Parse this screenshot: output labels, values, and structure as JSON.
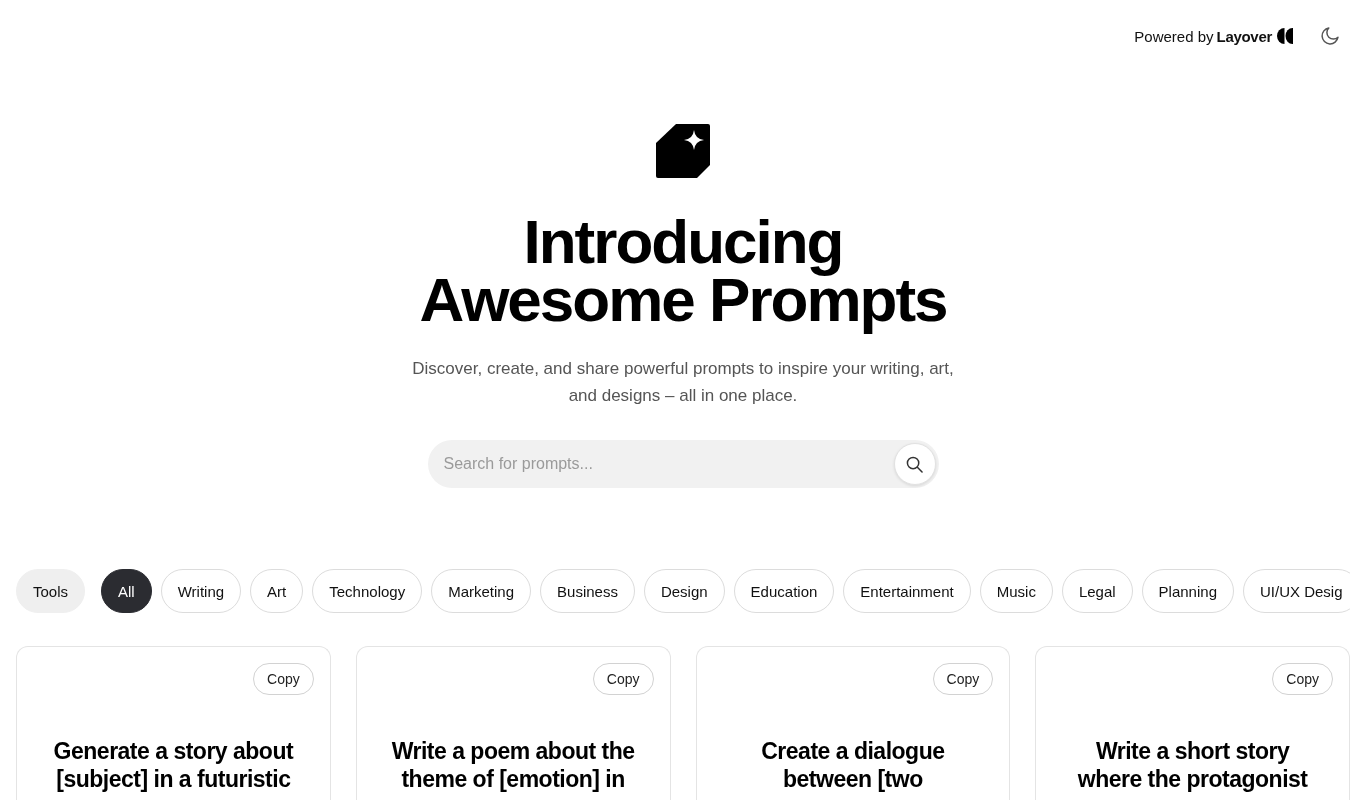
{
  "header": {
    "powered_by": "Powered by **Layover**"
  },
  "hero": {
    "title": "Introducing Awesome Prompts",
    "subtitle": "Discover, create, and share powerful prompts to inspire your writing, art, and designs – all in one place.",
    "search": {
      "placeholder": "Search for prompts..."
    }
  },
  "filters": {
    "tools_button": "Tools",
    "categories": [
      {
        "label": "All",
        "selected": true
      },
      {
        "label": "Writing",
        "selected": false
      },
      {
        "label": "Art",
        "selected": false
      },
      {
        "label": "Technology",
        "selected": false
      },
      {
        "label": "Marketing",
        "selected": false
      },
      {
        "label": "Business",
        "selected": false
      },
      {
        "label": "Design",
        "selected": false
      },
      {
        "label": "Education",
        "selected": false
      },
      {
        "label": "Entertainment",
        "selected": false
      },
      {
        "label": "Music",
        "selected": false
      },
      {
        "label": "Legal",
        "selected": false
      },
      {
        "label": "Planning",
        "selected": false
      },
      {
        "label": "UI/UX Desig",
        "selected": false
      }
    ]
  },
  "prompts": [
    {
      "text": "Generate a story about [subject] in a futuristic",
      "copy_label": "Copy"
    },
    {
      "text": "Write a poem about the theme of [emotion] in",
      "copy_label": "Copy"
    },
    {
      "text": "Create a dialogue between [two",
      "copy_label": "Copy"
    },
    {
      "text": "Write a short story where the protagonist",
      "copy_label": "Copy"
    }
  ]
}
